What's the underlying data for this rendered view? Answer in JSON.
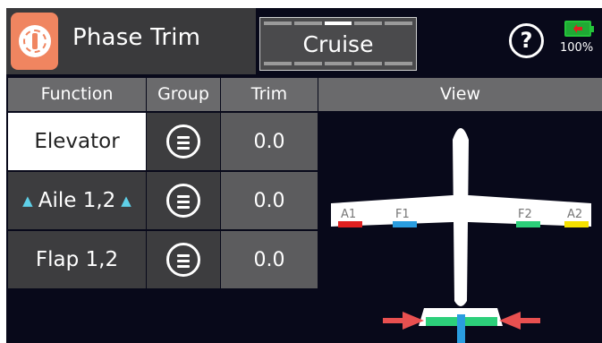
{
  "header": {
    "title": "Phase Trim",
    "phase": "Cruise",
    "help_symbol": "?",
    "battery": "100%"
  },
  "table": {
    "columns": [
      "Function",
      "Group",
      "Trim",
      "View"
    ],
    "rows": [
      {
        "function": "Elevator",
        "trim": "0.0",
        "selected": true
      },
      {
        "function": "Aile 1,2",
        "trim": "0.0",
        "selected": false
      },
      {
        "function": "Flap 1,2",
        "trim": "0.0",
        "selected": false
      }
    ]
  },
  "view": {
    "labels": [
      "A1",
      "F1",
      "F2",
      "A2"
    ]
  },
  "icons": {
    "app": "phase-trim-icon",
    "help": "help-icon",
    "battery": "battery-charging-icon",
    "group": "group-list-icon",
    "arrows": "triangle-up-icon"
  },
  "colors": {
    "accent": "#f08560",
    "selected_row": "#ffffff",
    "a1": "#e02020",
    "f1": "#2a9de0",
    "f2": "#2ccf7a",
    "a2": "#f5e000",
    "arrow": "#e85050",
    "elevator": "#2ccf7a",
    "rudder": "#2a9de0"
  }
}
